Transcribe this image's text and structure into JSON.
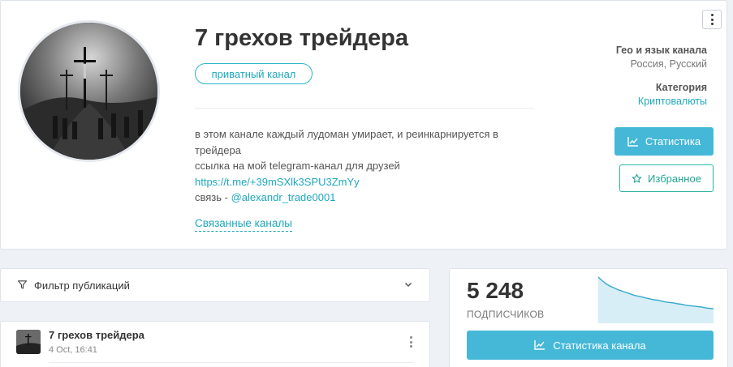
{
  "channel": {
    "title": "7 грехов трейдера",
    "badge": "приватный канал",
    "description": {
      "line1": "в этом канале каждый лудоман умирает, и реинкарнируется в трейдера",
      "line2": "ссылка на мой telegram-канал для друзей",
      "link": "https://t.me/+39mSXlk3SPU3ZmYy",
      "contact_prefix": "связь - ",
      "contact_handle": "@alexandr_trade0001"
    },
    "related_label": "Связанные каналы"
  },
  "meta": {
    "geo_label": "Гео и язык канала",
    "geo_value": "Россия, Русский",
    "category_label": "Категория",
    "category_value": "Криптовалюты"
  },
  "buttons": {
    "stats": "Статистика",
    "favorite": "Избранное",
    "channel_stats": "Статистика канала"
  },
  "filter": {
    "label": "Фильтр публикаций"
  },
  "post": {
    "title": "7 грехов трейдера",
    "date": "4 Oct, 16:41"
  },
  "subscribers": {
    "count": "5 248",
    "label": "ПОДПИСЧИКОВ",
    "trend": [
      100,
      92,
      85,
      80,
      76,
      72,
      69,
      66,
      63,
      60,
      58,
      56,
      54,
      52,
      50,
      49,
      47,
      45,
      44,
      43,
      41,
      40,
      38,
      37,
      36,
      35,
      34,
      32,
      31,
      30
    ]
  },
  "colors": {
    "accent": "#45b8d8",
    "link": "#1ea8bd",
    "favorite": "#1fa594"
  },
  "icons": {
    "menu": "vertical-dots-icon",
    "stats": "chart-line-icon",
    "favorite": "star-icon",
    "filter": "filter-icon",
    "chevron": "chevron-down-icon"
  }
}
